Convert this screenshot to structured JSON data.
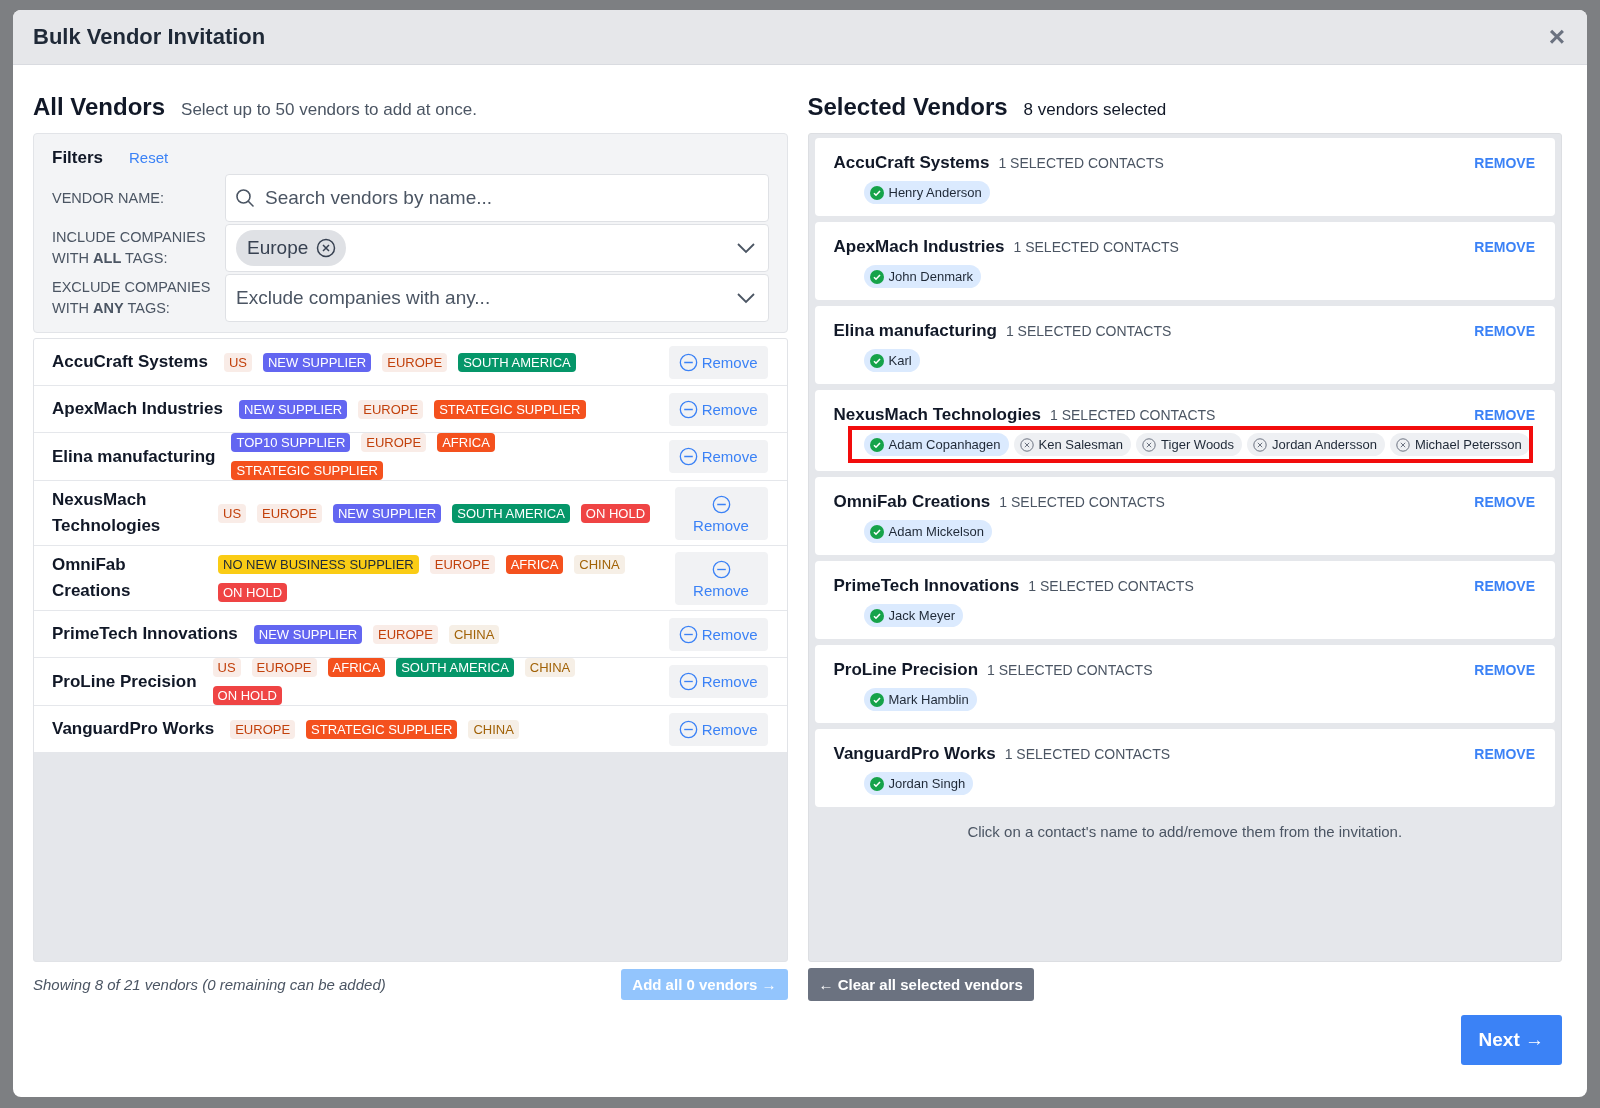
{
  "window": {
    "title": "Bulk Vendor Invitation",
    "close": "×"
  },
  "all_vendors": {
    "title": "All Vendors",
    "subtitle": "Select up to 50 vendors to add at once.",
    "filters": {
      "title": "Filters",
      "reset": "Reset",
      "fields": [
        {
          "kind": "search",
          "label": "VENDOR NAME:",
          "placeholder": "Search vendors by name..."
        },
        {
          "kind": "tags",
          "label": "INCLUDE COMPANIES WITH **ALL** TAGS:",
          "tags": [
            {
              "label": "Europe"
            }
          ]
        },
        {
          "kind": "select",
          "label": "EXCLUDE COMPANIES WITH **ANY** TAGS:",
          "placeholder": "Exclude companies with any..."
        }
      ]
    },
    "vendors": [
      {
        "name": "AccuCraft Systems",
        "wrapped": false,
        "action": "Remove",
        "tags": [
          {
            "label": "US",
            "kind": "soft",
            "color": "#c2410c"
          },
          {
            "label": "NEW SUPPLIER",
            "kind": "solid",
            "color": "#6366f1"
          },
          {
            "label": "EUROPE",
            "kind": "soft",
            "color": "#c2410c"
          },
          {
            "label": "SOUTH AMERICA",
            "kind": "solid",
            "color": "#059669"
          }
        ]
      },
      {
        "name": "ApexMach Industries",
        "wrapped": false,
        "action": "Remove",
        "tags": [
          {
            "label": "NEW SUPPLIER",
            "kind": "solid",
            "color": "#6366f1"
          },
          {
            "label": "EUROPE",
            "kind": "soft",
            "color": "#c2410c"
          },
          {
            "label": "STRATEGIC SUPPLIER",
            "kind": "solid",
            "color": "#f4511e"
          }
        ]
      },
      {
        "name": "Elina manufacturing",
        "wrapped": false,
        "action": "Remove",
        "tags": [
          {
            "label": "TOP10 SUPPLIER",
            "kind": "solid",
            "color": "#6366f1"
          },
          {
            "label": "EUROPE",
            "kind": "soft",
            "color": "#c2410c"
          },
          {
            "label": "AFRICA",
            "kind": "solid",
            "color": "#f4511e"
          },
          {
            "label": "STRATEGIC SUPPLIER",
            "kind": "solid",
            "color": "#f4511e"
          }
        ]
      },
      {
        "name": "NexusMach Technologies",
        "wrapped": true,
        "action": "Remove",
        "tags": [
          {
            "label": "US",
            "kind": "soft",
            "color": "#c2410c"
          },
          {
            "label": "EUROPE",
            "kind": "soft",
            "color": "#c2410c"
          },
          {
            "label": "NEW SUPPLIER",
            "kind": "solid",
            "color": "#6366f1"
          },
          {
            "label": "SOUTH AMERICA",
            "kind": "solid",
            "color": "#059669"
          },
          {
            "label": "ON HOLD",
            "kind": "solid",
            "color": "#ef4444"
          }
        ]
      },
      {
        "name": "OmniFab Creations",
        "wrapped": true,
        "action": "Remove",
        "tags": [
          {
            "label": "NO NEW BUSINESS SUPPLIER",
            "kind": "solid",
            "color": "#facc15"
          },
          {
            "label": "EUROPE",
            "kind": "soft",
            "color": "#c2410c"
          },
          {
            "label": "AFRICA",
            "kind": "solid",
            "color": "#f4511e"
          },
          {
            "label": "CHINA",
            "kind": "soft",
            "color": "#a16207"
          },
          {
            "label": "ON HOLD",
            "kind": "solid",
            "color": "#ef4444"
          }
        ]
      },
      {
        "name": "PrimeTech Innovations",
        "wrapped": false,
        "action": "Remove",
        "tags": [
          {
            "label": "NEW SUPPLIER",
            "kind": "solid",
            "color": "#6366f1"
          },
          {
            "label": "EUROPE",
            "kind": "soft",
            "color": "#c2410c"
          },
          {
            "label": "CHINA",
            "kind": "soft",
            "color": "#a16207"
          }
        ]
      },
      {
        "name": "ProLine Precision",
        "wrapped": false,
        "action": "Remove",
        "tags": [
          {
            "label": "US",
            "kind": "soft",
            "color": "#c2410c"
          },
          {
            "label": "EUROPE",
            "kind": "soft",
            "color": "#c2410c"
          },
          {
            "label": "AFRICA",
            "kind": "solid",
            "color": "#f4511e"
          },
          {
            "label": "SOUTH AMERICA",
            "kind": "solid",
            "color": "#059669"
          },
          {
            "label": "CHINA",
            "kind": "soft",
            "color": "#a16207"
          },
          {
            "label": "ON HOLD",
            "kind": "solid",
            "color": "#ef4444"
          }
        ]
      },
      {
        "name": "VanguardPro Works",
        "wrapped": false,
        "action": "Remove",
        "tags": [
          {
            "label": "EUROPE",
            "kind": "soft",
            "color": "#c2410c"
          },
          {
            "label": "STRATEGIC SUPPLIER",
            "kind": "solid",
            "color": "#f4511e"
          },
          {
            "label": "CHINA",
            "kind": "soft",
            "color": "#a16207"
          }
        ]
      }
    ],
    "footer_note": "Showing 8 of 21 vendors (0 remaining can be added)",
    "add_all": {
      "label": "Add all 0 vendors →",
      "disabled": true
    }
  },
  "selected_vendors": {
    "title": "Selected Vendors",
    "count": "8 vendors selected",
    "vendors": [
      {
        "name": "AccuCraft Systems",
        "count": "1 SELECTED CONTACTS",
        "action": "REMOVE",
        "highlighted": false,
        "contacts": [
          {
            "name": "Henry Anderson",
            "selected": true
          }
        ]
      },
      {
        "name": "ApexMach Industries",
        "count": "1 SELECTED CONTACTS",
        "action": "REMOVE",
        "highlighted": false,
        "contacts": [
          {
            "name": "John Denmark",
            "selected": true
          }
        ]
      },
      {
        "name": "Elina manufacturing",
        "count": "1 SELECTED CONTACTS",
        "action": "REMOVE",
        "highlighted": false,
        "contacts": [
          {
            "name": "Karl",
            "selected": true
          }
        ]
      },
      {
        "name": "NexusMach Technologies",
        "count": "1 SELECTED CONTACTS",
        "action": "REMOVE",
        "highlighted": true,
        "contacts": [
          {
            "name": "Adam Copanhagen",
            "selected": true
          },
          {
            "name": "Ken Salesman",
            "selected": false
          },
          {
            "name": "Tiger Woods",
            "selected": false
          },
          {
            "name": "Jordan Andersson",
            "selected": false
          },
          {
            "name": "Michael Petersson",
            "selected": false
          }
        ]
      },
      {
        "name": "OmniFab Creations",
        "count": "1 SELECTED CONTACTS",
        "action": "REMOVE",
        "highlighted": false,
        "contacts": [
          {
            "name": "Adam Mickelson",
            "selected": true
          }
        ]
      },
      {
        "name": "PrimeTech Innovations",
        "count": "1 SELECTED CONTACTS",
        "action": "REMOVE",
        "highlighted": false,
        "contacts": [
          {
            "name": "Jack Meyer",
            "selected": true
          }
        ]
      },
      {
        "name": "ProLine Precision",
        "count": "1 SELECTED CONTACTS",
        "action": "REMOVE",
        "highlighted": false,
        "contacts": [
          {
            "name": "Mark Hamblin",
            "selected": true
          }
        ]
      },
      {
        "name": "VanguardPro Works",
        "count": "1 SELECTED CONTACTS",
        "action": "REMOVE",
        "highlighted": false,
        "contacts": [
          {
            "name": "Jordan Singh",
            "selected": true
          }
        ]
      }
    ],
    "hint": "Click on a contact's name to add/remove them from the invitation.",
    "clear_all": "← Clear all selected vendors"
  },
  "next": "Next →"
}
